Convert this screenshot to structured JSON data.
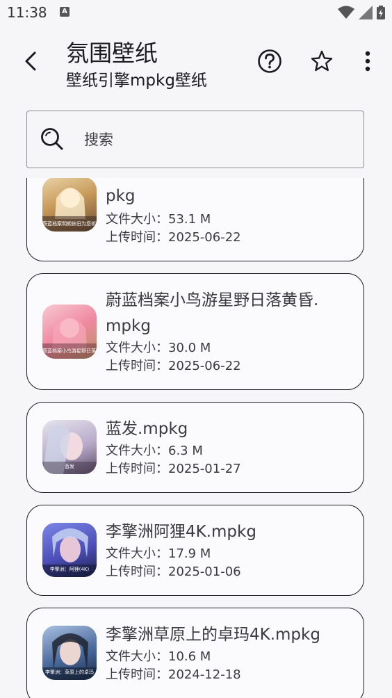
{
  "status_bar": {
    "time": "11:38",
    "notification_badge": "A"
  },
  "header": {
    "title": "氛围壁纸",
    "subtitle": "壁纸引擎mpkg壁纸",
    "actions": [
      "help-icon",
      "star-icon",
      "more-vert-icon"
    ]
  },
  "search": {
    "placeholder": "搜索",
    "value": ""
  },
  "files": [
    {
      "name": "蔚蓝档案-明朗依旧为您祈祷.mpkg",
      "size_label": "文件大小：53.1 M",
      "date_label": "上传时间：2025-06-22",
      "thumb_caption": "蔚蓝档案明朗依旧为您祈祷",
      "accent": "#d9b27a"
    },
    {
      "name": "蔚蓝档案小鸟游星野日落黄昏.mpkg",
      "size_label": "文件大小：30.0 M",
      "date_label": "上传时间：2025-06-22",
      "thumb_caption": "蔚蓝档案小鸟游星野日落黄昏",
      "accent": "#f3a3b4"
    },
    {
      "name": "蓝发.mpkg",
      "size_label": "文件大小：6.3 M",
      "date_label": "上传时间：2025-01-27",
      "thumb_caption": "蓝发",
      "accent": "#c9c3da"
    },
    {
      "name": "李擎洲阿狸4K.mpkg",
      "size_label": "文件大小：17.9 M",
      "date_label": "上传时间：2025-01-06",
      "thumb_caption": "李擎洲：阿狸(4K)",
      "accent": "#5a6fd1"
    },
    {
      "name": "李擎洲草原上的卓玛4K.mpkg",
      "size_label": "文件大小：10.6 M",
      "date_label": "上传时间：2024-12-18",
      "thumb_caption": "李擎洲：草原上的卓玛",
      "accent": "#3b5a8a"
    }
  ]
}
